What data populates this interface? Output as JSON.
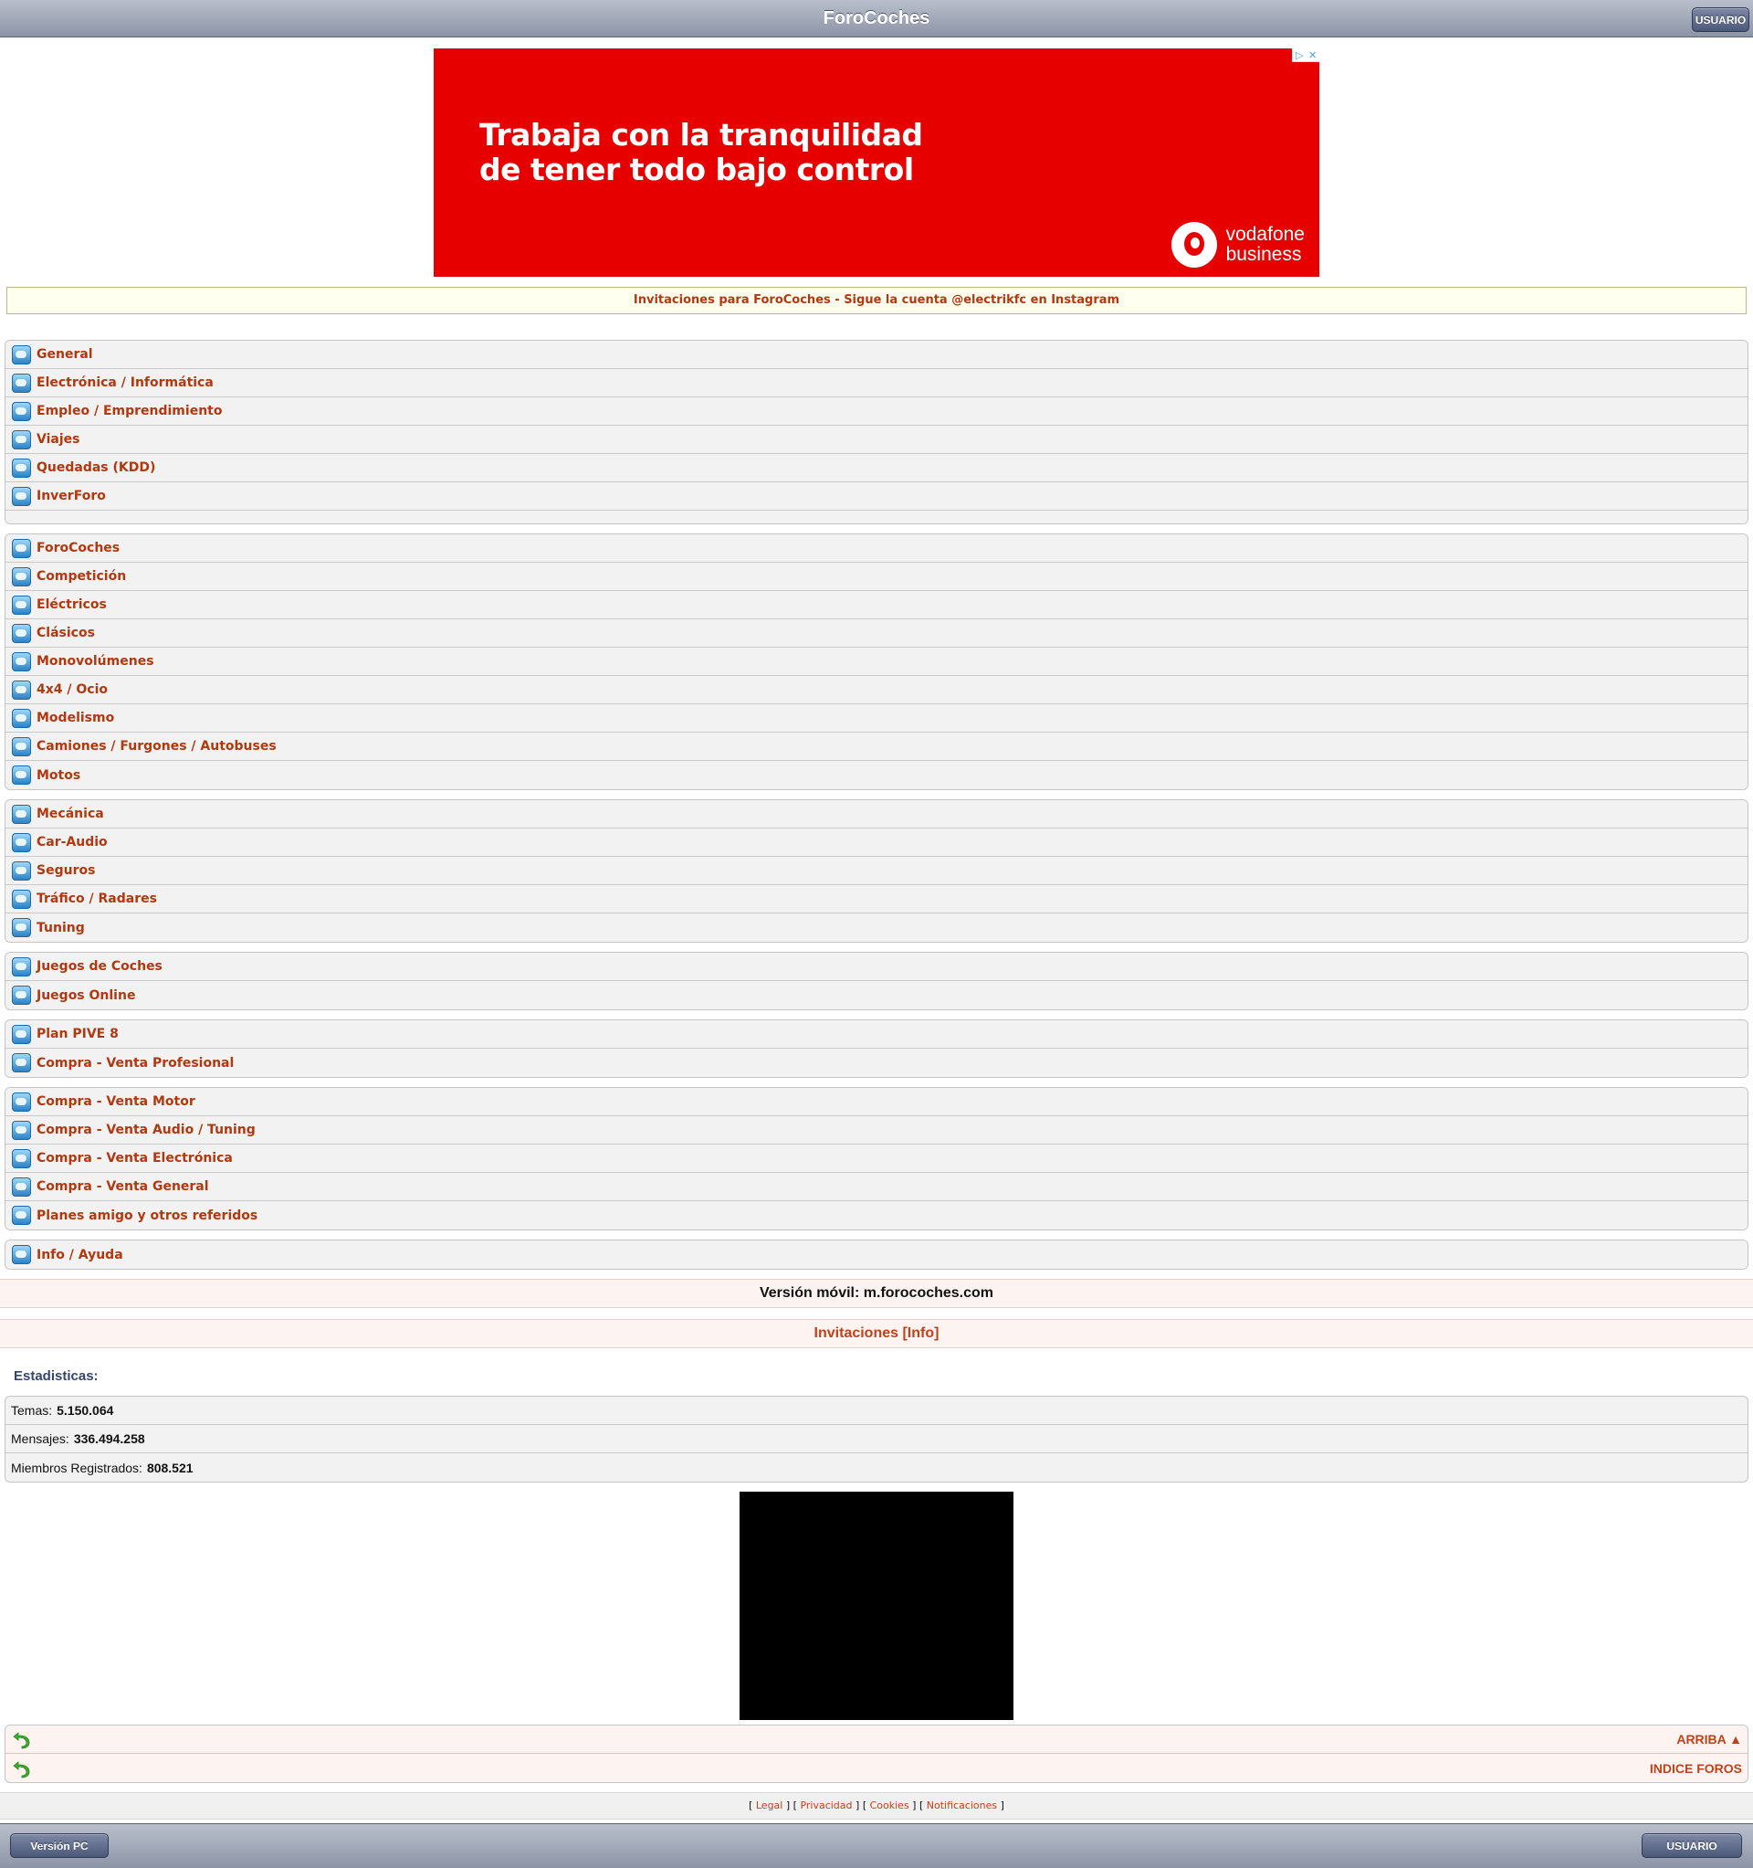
{
  "header": {
    "title": "ForoCoches",
    "user_button": "USUARIO"
  },
  "ad": {
    "close_icons": [
      "▷",
      "✕"
    ],
    "headline_line1": "Trabaja con la tranquilidad",
    "headline_line2": "de tener todo bajo control",
    "brand_line1": "vodafone",
    "brand_line2": "business",
    "background_color": "#e60000"
  },
  "invite_banner": "Invitaciones para ForoCoches - Sigue la cuenta @electrikfc en Instagram",
  "forum_groups": [
    {
      "items": [
        "General",
        "Electrónica / Informática",
        "Empleo / Emprendimiento",
        "Viajes",
        "Quedadas (KDD)",
        "InverForo"
      ]
    },
    {
      "items": [
        "ForoCoches",
        "Competición",
        "Eléctricos",
        "Clásicos",
        "Monovolúmenes",
        "4x4 / Ocio",
        "Modelismo",
        "Camiones / Furgones / Autobuses",
        "Motos"
      ]
    },
    {
      "items": [
        "Mecánica",
        "Car-Audio",
        "Seguros",
        "Tráfico / Radares",
        "Tuning"
      ]
    },
    {
      "items": [
        "Juegos de Coches",
        "Juegos Online"
      ]
    },
    {
      "items": [
        "Plan PIVE 8",
        "Compra - Venta Profesional"
      ]
    },
    {
      "items": [
        "Compra - Venta Motor",
        "Compra - Venta Audio / Tuning",
        "Compra - Venta Electrónica",
        "Compra - Venta General",
        "Planes amigo y otros referidos"
      ]
    },
    {
      "items": [
        "Info / Ayuda"
      ]
    }
  ],
  "mobile_version": "Versión móvil: m.forocoches.com",
  "invitations": "Invitaciones [Info]",
  "stats": {
    "title": "Estadisticas:",
    "rows": [
      {
        "label": "Temas:",
        "value": "5.150.064"
      },
      {
        "label": "Mensajes:",
        "value": "336.494.258"
      },
      {
        "label": "Miembros Registrados:",
        "value": "808.521"
      }
    ]
  },
  "nav": {
    "top_label": "ARRIBA ▲",
    "index_label": "INDICE FOROS"
  },
  "footer": {
    "links": [
      "Legal",
      "Privacidad",
      "Cookies",
      "Notificaciones"
    ]
  },
  "bottom_bar": {
    "pc_button": "Versión PC",
    "user_button": "USUARIO"
  },
  "colors": {
    "link": "#b2380f",
    "accent": "#c0411a",
    "bar": "#8c94a6"
  }
}
